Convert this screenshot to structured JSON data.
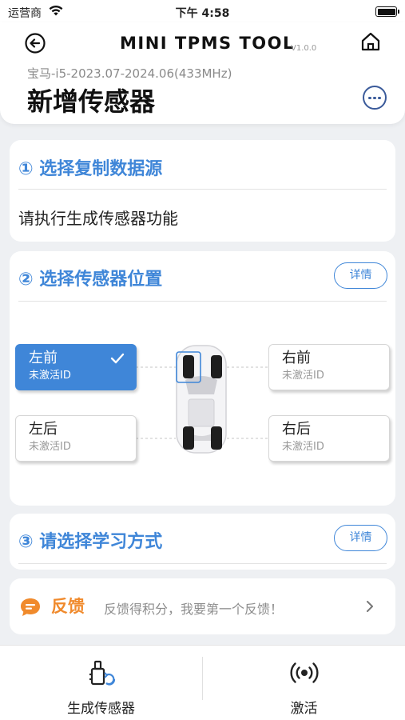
{
  "status_bar": {
    "carrier": "运营商",
    "time": "下午 4:58"
  },
  "header": {
    "app_title": "MINI TPMS TOOL",
    "version": "V1.0.0",
    "subtitle": "宝马-i5-2023.07-2024.06(433MHz)",
    "page_title": "新增传感器"
  },
  "step1": {
    "title": "① 选择复制数据源",
    "message": "请执行生成传感器功能"
  },
  "step2": {
    "title": "② 选择传感器位置",
    "detail_label": "详情",
    "tires": {
      "front_left": {
        "position": "左前",
        "state": "未激活ID",
        "selected": true
      },
      "front_right": {
        "position": "右前",
        "state": "未激活ID",
        "selected": false
      },
      "rear_left": {
        "position": "左后",
        "state": "未激活ID",
        "selected": false
      },
      "rear_right": {
        "position": "右后",
        "state": "未激活ID",
        "selected": false
      }
    }
  },
  "step3": {
    "title": "③ 请选择学习方式",
    "detail_label": "详情"
  },
  "feedback": {
    "title": "反馈",
    "text": "反馈得积分，我要第一个反馈！"
  },
  "tabbar": {
    "generate_label": "生成传感器",
    "activate_label": "激活"
  },
  "colors": {
    "accent_blue": "#3f86d8",
    "feedback_orange": "#f08a2c",
    "background": "#eef0f3"
  },
  "icons": [
    "wifi-icon",
    "battery-icon",
    "back-icon",
    "home-icon",
    "more-icon",
    "check-icon",
    "feedback-icon",
    "chevron-right-icon",
    "generate-sensor-icon",
    "activate-signal-icon"
  ]
}
